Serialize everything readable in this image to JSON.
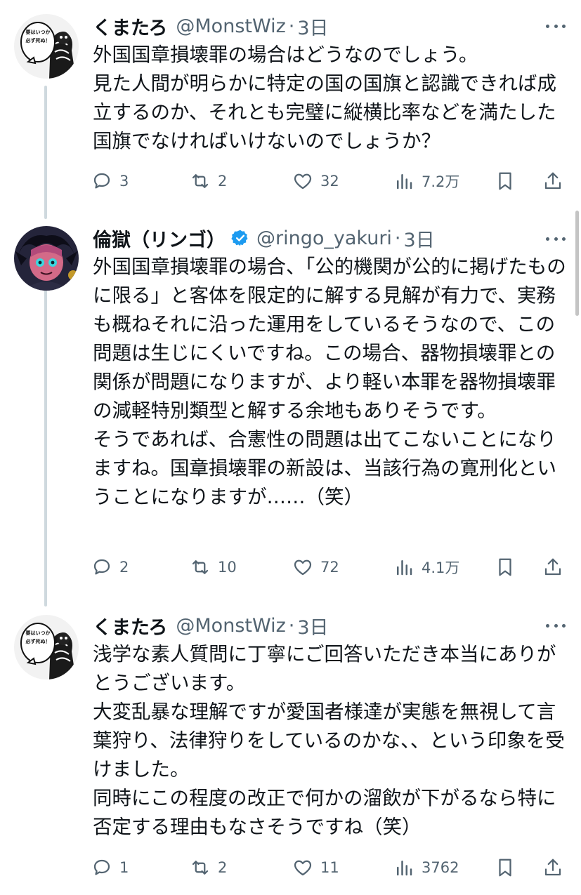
{
  "tweets": [
    {
      "name": "くまたろ",
      "handle": "@MonstWiz",
      "separator": "·",
      "time": "3日",
      "text": "外国国章損壊罪の場合はどうなのでしょう。\n見た人間が明らかに特定の国の国旗と認識できれば成立するのか、それとも完璧に縦横比率などを満たした国旗でなければいけないのでしょうか？",
      "replies": "3",
      "retweets": "2",
      "likes": "32",
      "views": "7.2万",
      "avatar_bubble": "要はいつか必ず死ぬ！"
    },
    {
      "name": "倫獄（リンゴ）",
      "verified": true,
      "handle": "@ringo_yakuri",
      "separator": "·",
      "time": "3日",
      "text": "外国国章損壊罪の場合、「公的機関が公的に掲げたものに限る」と客体を限定的に解する見解が有力で、実務も概ねそれに沿った運用をしているそうなので、この問題は生じにくいですね。この場合、器物損壊罪との関係が問題になりますが、より軽い本罪を器物損壊罪の減軽特別類型と解する余地もありそうです。\nそうであれば、合憲性の問題は出てこないことになりますね。国章損壊罪の新設は、当該行為の寛刑化ということになりますが……（笑）",
      "replies": "2",
      "retweets": "10",
      "likes": "72",
      "views": "4.1万"
    },
    {
      "name": "くまたろ",
      "handle": "@MonstWiz",
      "separator": "·",
      "time": "3日",
      "text": "浅学な素人質問に丁寧にご回答いただき本当にありがとうございます。\n大変乱暴な理解ですが愛国者様達が実態を無視して言葉狩り、法律狩りをしているのかな、、という印象を受けました。\n同時にこの程度の改正で何かの溜飲が下がるなら特に否定する理由もなさそうですね（笑）",
      "replies": "1",
      "retweets": "2",
      "likes": "11",
      "views": "3762",
      "avatar_bubble": "要はいつか必ず死ぬ！"
    }
  ],
  "icons": {
    "reply": "speech-bubble-icon",
    "retweet": "retweet-arrows-icon",
    "like": "heart-icon",
    "views": "bar-chart-icon",
    "bookmark": "bookmark-icon",
    "share": "share-upload-icon",
    "more": "more-dots-icon",
    "verified": "verified-badge-icon"
  },
  "colors": {
    "text": "#0f1419",
    "secondary": "#536471",
    "verified": "#1d9bf0",
    "thread_line": "#cfd9de"
  }
}
